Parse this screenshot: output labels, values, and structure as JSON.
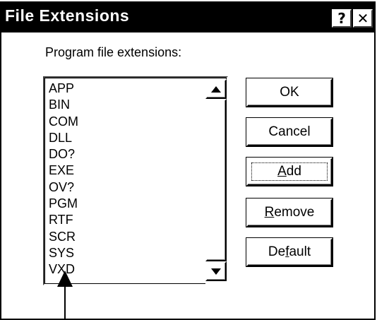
{
  "window": {
    "title": "File Extensions",
    "help_button": "?",
    "close_button": "✕"
  },
  "label": "Program file extensions:",
  "extensions": [
    "APP",
    "BIN",
    "COM",
    "DLL",
    "DO?",
    "EXE",
    "OV?",
    "PGM",
    "RTF",
    "SCR",
    "SYS",
    "VXD"
  ],
  "buttons": {
    "ok": "OK",
    "cancel": "Cancel",
    "add": {
      "mnemonic": "A",
      "rest": "dd"
    },
    "remove": {
      "mnemonic": "R",
      "rest": "emove"
    },
    "default": {
      "pre": "De",
      "mnemonic": "f",
      "rest": "ault"
    }
  },
  "icons": {
    "scroll_up": "triangle-up-icon",
    "scroll_down": "triangle-down-icon",
    "pointer": "arrow-up-icon"
  }
}
